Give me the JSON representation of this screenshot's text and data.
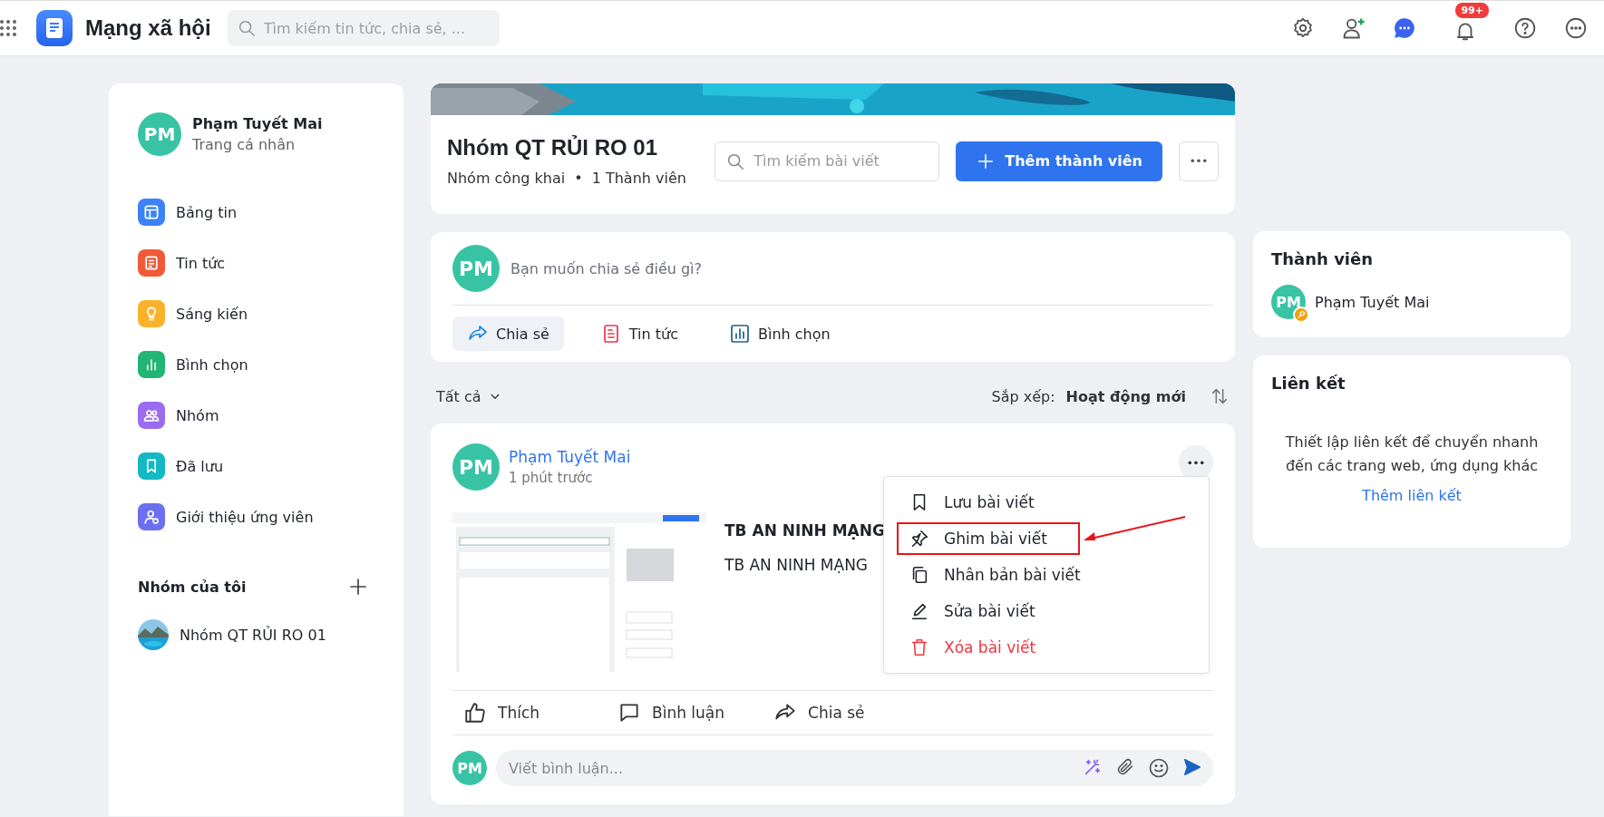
{
  "topbar": {
    "app_title": "Mạng xã hội",
    "search": {
      "placeholder": "Tìm kiếm tin tức, chia sẻ, ..."
    },
    "notification_badge": "99+"
  },
  "profile": {
    "initials": "PM",
    "name": "Phạm Tuyết Mai",
    "subtitle": "Trang cá nhân"
  },
  "nav": [
    {
      "label": "Bảng tin",
      "kind": "feed",
      "color": "#3b82f6"
    },
    {
      "label": "Tin tức",
      "kind": "news",
      "color": "#f05a38"
    },
    {
      "label": "Sáng kiến",
      "kind": "idea",
      "color": "#fbb22b"
    },
    {
      "label": "Bình chọn",
      "kind": "poll",
      "color": "#22b573"
    },
    {
      "label": "Nhóm",
      "kind": "group",
      "color": "#9b6cf0"
    },
    {
      "label": "Đã lưu",
      "kind": "saved",
      "color": "#14b8c4"
    },
    {
      "label": "Giới thiệu ứng viên",
      "kind": "referral",
      "color": "#6d6ff0"
    }
  ],
  "my_groups": {
    "title": "Nhóm của tôi",
    "items": [
      {
        "name": "Nhóm QT RỦI RO 01"
      }
    ]
  },
  "group": {
    "name": "Nhóm QT RỦI RO 01",
    "privacy": "Nhóm công khai",
    "separator": "•",
    "members_count": "1 Thành viên",
    "search": {
      "placeholder": "Tìm kiếm bài viết"
    },
    "add_member_button": "Thêm thành viên"
  },
  "composer": {
    "initials": "PM",
    "placeholder": "Bạn muốn chia sẻ điều gì?",
    "actions": [
      {
        "label": "Chia sẻ",
        "kind": "share",
        "selected": true
      },
      {
        "label": "Tin tức",
        "kind": "news",
        "selected": false
      },
      {
        "label": "Bình chọn",
        "kind": "poll",
        "selected": false
      }
    ]
  },
  "feed_filter": {
    "filter": "Tất cả",
    "sort_label": "Sắp xếp:",
    "sort_value": "Hoạt động mới"
  },
  "post": {
    "initials": "PM",
    "author": "Phạm Tuyết Mai",
    "time": "1 phút trước",
    "title": "TB AN NINH MẠNG",
    "body": "TB AN NINH MẠNG",
    "menu": [
      {
        "label": "Lưu bài viết",
        "kind": "save",
        "highlighted": false
      },
      {
        "label": "Ghim bài viết",
        "kind": "pin",
        "highlighted": true
      },
      {
        "label": "Nhân bản bài viết",
        "kind": "duplicate",
        "highlighted": false
      },
      {
        "label": "Sửa bài viết",
        "kind": "edit",
        "highlighted": false
      },
      {
        "label": "Xóa bài viết",
        "kind": "delete",
        "highlighted": false
      }
    ],
    "actions": [
      {
        "label": "Thích",
        "kind": "like"
      },
      {
        "label": "Bình luận",
        "kind": "comment"
      },
      {
        "label": "Chia sẻ",
        "kind": "share"
      }
    ],
    "comment": {
      "initials": "PM",
      "placeholder": "Viết bình luận..."
    }
  },
  "members": {
    "title": "Thành viên",
    "items": [
      {
        "initials": "PM",
        "name": "Phạm Tuyết Mai",
        "admin": true
      }
    ]
  },
  "links": {
    "title": "Liên kết",
    "empty_text": "Thiết lập liên kết để chuyển nhanh đến các trang web, ứng dụng khác",
    "add_link": "Thêm liên kết"
  }
}
